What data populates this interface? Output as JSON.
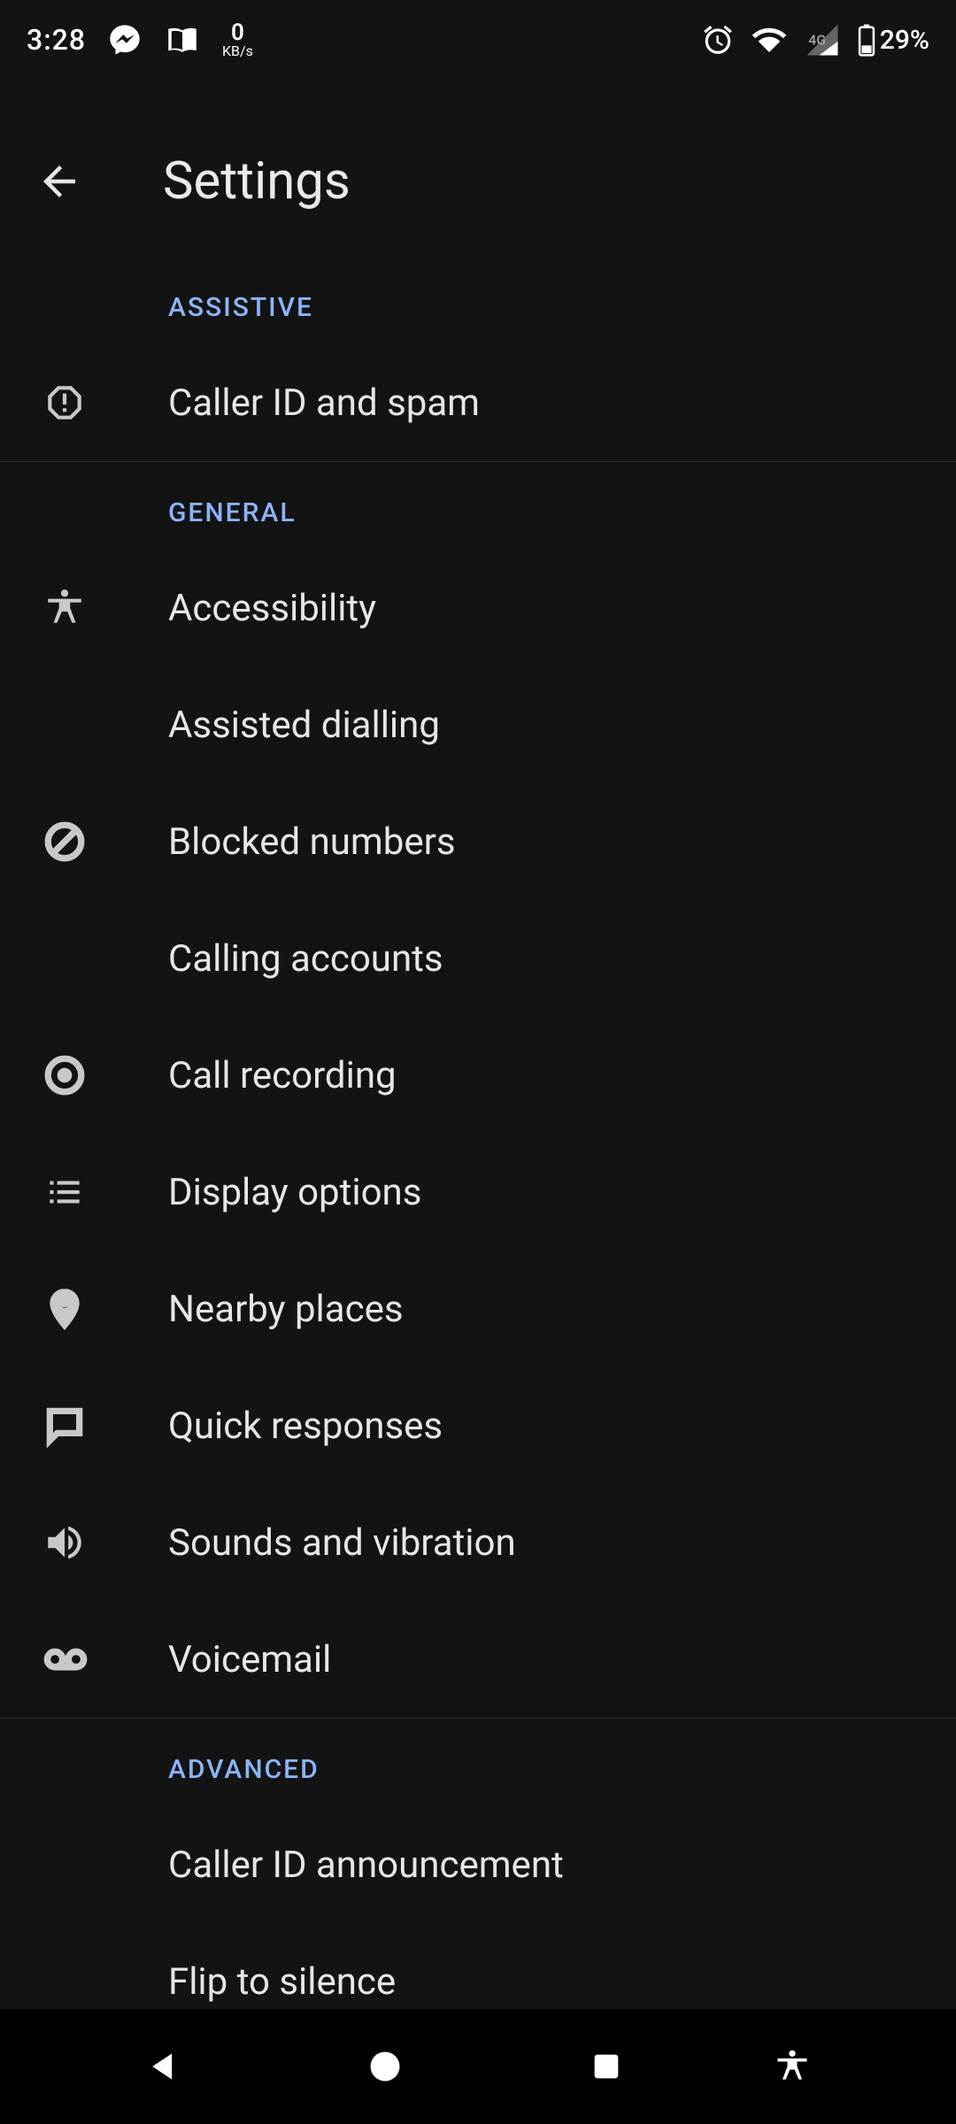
{
  "status": {
    "time": "3:28",
    "netspeed_value": "0",
    "netspeed_unit": "KB/s",
    "battery_pct": "29%"
  },
  "appbar": {
    "title": "Settings"
  },
  "sections": {
    "assistive": {
      "header": "ASSISTIVE",
      "items": {
        "caller_id_spam": "Caller ID and spam"
      }
    },
    "general": {
      "header": "GENERAL",
      "items": {
        "accessibility": "Accessibility",
        "assisted_dialling": "Assisted dialling",
        "blocked_numbers": "Blocked numbers",
        "calling_accounts": "Calling accounts",
        "call_recording": "Call recording",
        "display_options": "Display options",
        "nearby_places": "Nearby places",
        "quick_responses": "Quick responses",
        "sounds_vibration": "Sounds and vibration",
        "voicemail": "Voicemail"
      }
    },
    "advanced": {
      "header": "ADVANCED",
      "items": {
        "caller_id_announcement": "Caller ID announcement",
        "flip_to_silence": "Flip to silence"
      }
    }
  }
}
